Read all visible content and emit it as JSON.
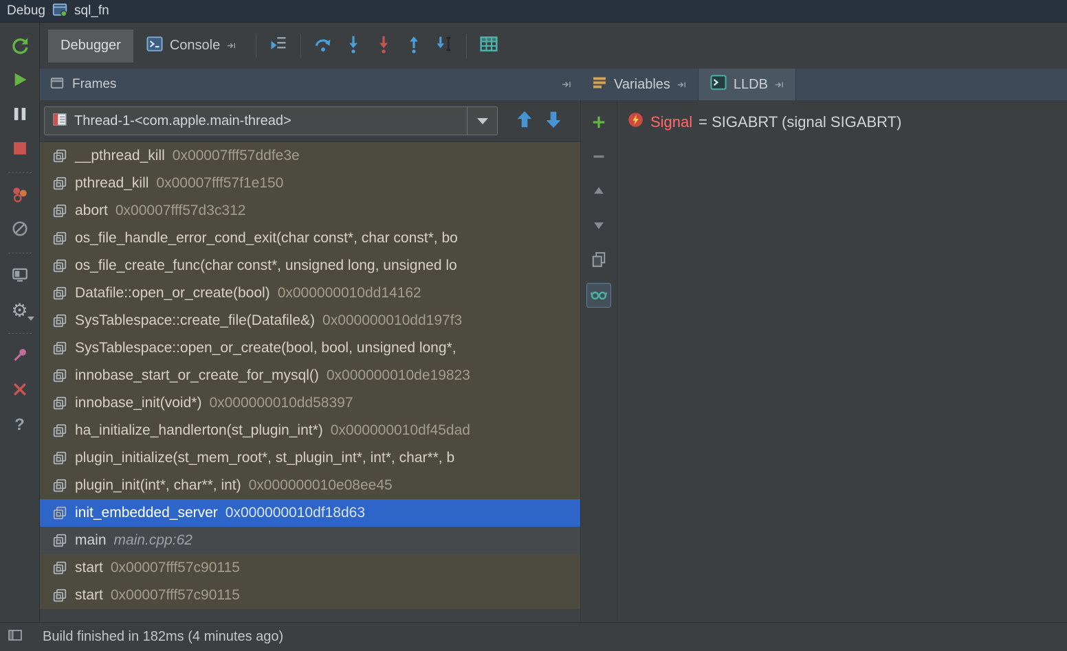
{
  "titlebar": {
    "title": "Debug",
    "session": "sql_fn"
  },
  "toolbar": {
    "tabs": [
      {
        "label": "Debugger",
        "active": true
      },
      {
        "label": "Console",
        "active": false
      }
    ],
    "actions": [
      "show-execution-point",
      "step-over",
      "step-into",
      "force-step-into",
      "step-out",
      "run-to-cursor",
      "view-as-table"
    ]
  },
  "debug_controls": [
    "rerun",
    "resume",
    "pause",
    "stop",
    "view-breakpoints",
    "mute-breakpoints",
    "restore-layout",
    "settings",
    "pin-tab",
    "close",
    "help"
  ],
  "frames_panel": {
    "header_label": "Frames",
    "thread_selector": {
      "value": "Thread-1-<com.apple.main-thread>"
    },
    "frames": [
      {
        "name": "__pthread_kill",
        "detail": "0x00007fff57ddfe3e",
        "type": "lib"
      },
      {
        "name": "pthread_kill",
        "detail": "0x00007fff57f1e150",
        "type": "lib"
      },
      {
        "name": "abort",
        "detail": "0x00007fff57d3c312",
        "type": "lib"
      },
      {
        "name": "os_file_handle_error_cond_exit(char const*, char const*, bo",
        "detail": "",
        "type": "lib"
      },
      {
        "name": "os_file_create_func(char const*, unsigned long, unsigned lo",
        "detail": "",
        "type": "lib"
      },
      {
        "name": "Datafile::open_or_create(bool)",
        "detail": "0x000000010dd14162",
        "type": "lib"
      },
      {
        "name": "SysTablespace::create_file(Datafile&)",
        "detail": "0x000000010dd197f3",
        "type": "lib"
      },
      {
        "name": "SysTablespace::open_or_create(bool, bool, unsigned long*,",
        "detail": "",
        "type": "lib"
      },
      {
        "name": "innobase_start_or_create_for_mysql()",
        "detail": "0x000000010de19823",
        "type": "lib"
      },
      {
        "name": "innobase_init(void*)",
        "detail": "0x000000010dd58397",
        "type": "lib"
      },
      {
        "name": "ha_initialize_handlerton(st_plugin_int*)",
        "detail": "0x000000010df45dad",
        "type": "lib"
      },
      {
        "name": "plugin_initialize(st_mem_root*, st_plugin_int*, int*, char**, b",
        "detail": "",
        "type": "lib"
      },
      {
        "name": "plugin_init(int*, char**, int)",
        "detail": "0x000000010e08ee45",
        "type": "lib"
      },
      {
        "name": "init_embedded_server",
        "detail": "0x000000010df18d63",
        "type": "lib",
        "selected": true
      },
      {
        "name": "main",
        "detail": "main.cpp:62",
        "type": "source"
      },
      {
        "name": "start",
        "detail": "0x00007fff57c90115",
        "type": "lib"
      },
      {
        "name": "start",
        "detail": "0x00007fff57c90115",
        "type": "lib"
      }
    ]
  },
  "watch_toolbar": [
    "add-watch",
    "remove-watch",
    "move-up",
    "move-down",
    "duplicate-watch",
    "show-watches"
  ],
  "variables_panel": {
    "tabs": [
      {
        "label": "Variables"
      },
      {
        "label": "LLDB"
      }
    ],
    "rows": [
      {
        "name": "Signal",
        "value": "= SIGABRT (signal SIGABRT)"
      }
    ]
  },
  "status_bar": {
    "message": "Build finished in 182ms (4 minutes ago)"
  },
  "colors": {
    "selection_blue": "#2D65C9",
    "frames_background": "#4D4A40",
    "header_background": "#3E4A58",
    "panel_background": "#3C3F41",
    "signal_name_red": "#FF6B68",
    "run_green": "#64B546",
    "stop_red": "#C75450",
    "step_blue": "#4A9EDA"
  }
}
